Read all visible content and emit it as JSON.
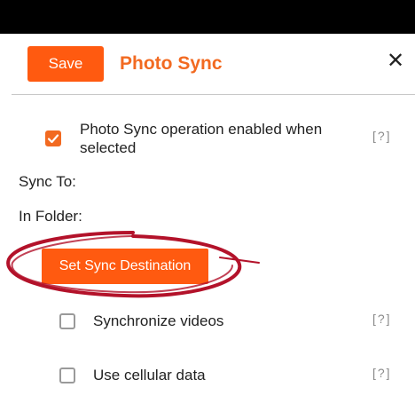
{
  "header": {
    "save_label": "Save",
    "title": "Photo Sync",
    "close_symbol": "✕"
  },
  "options": {
    "enabled_label_line1": "Photo Sync operation enabled when",
    "enabled_label_line2": "selected",
    "enabled_checked": true,
    "help_text": "[?]"
  },
  "destination": {
    "sync_to_label": "Sync To:",
    "in_folder_label": "In Folder:",
    "button_label": "Set Sync Destination"
  },
  "extra_options": {
    "videos_label": "Synchronize videos",
    "videos_checked": false,
    "cellular_label": "Use cellular data",
    "cellular_checked": false,
    "help_text": "[?]"
  },
  "colors": {
    "accent": "#f26a21",
    "button": "#ff5a10",
    "annotation": "#b3122a"
  },
  "icons": {
    "close": "close-icon",
    "check": "check-icon"
  }
}
